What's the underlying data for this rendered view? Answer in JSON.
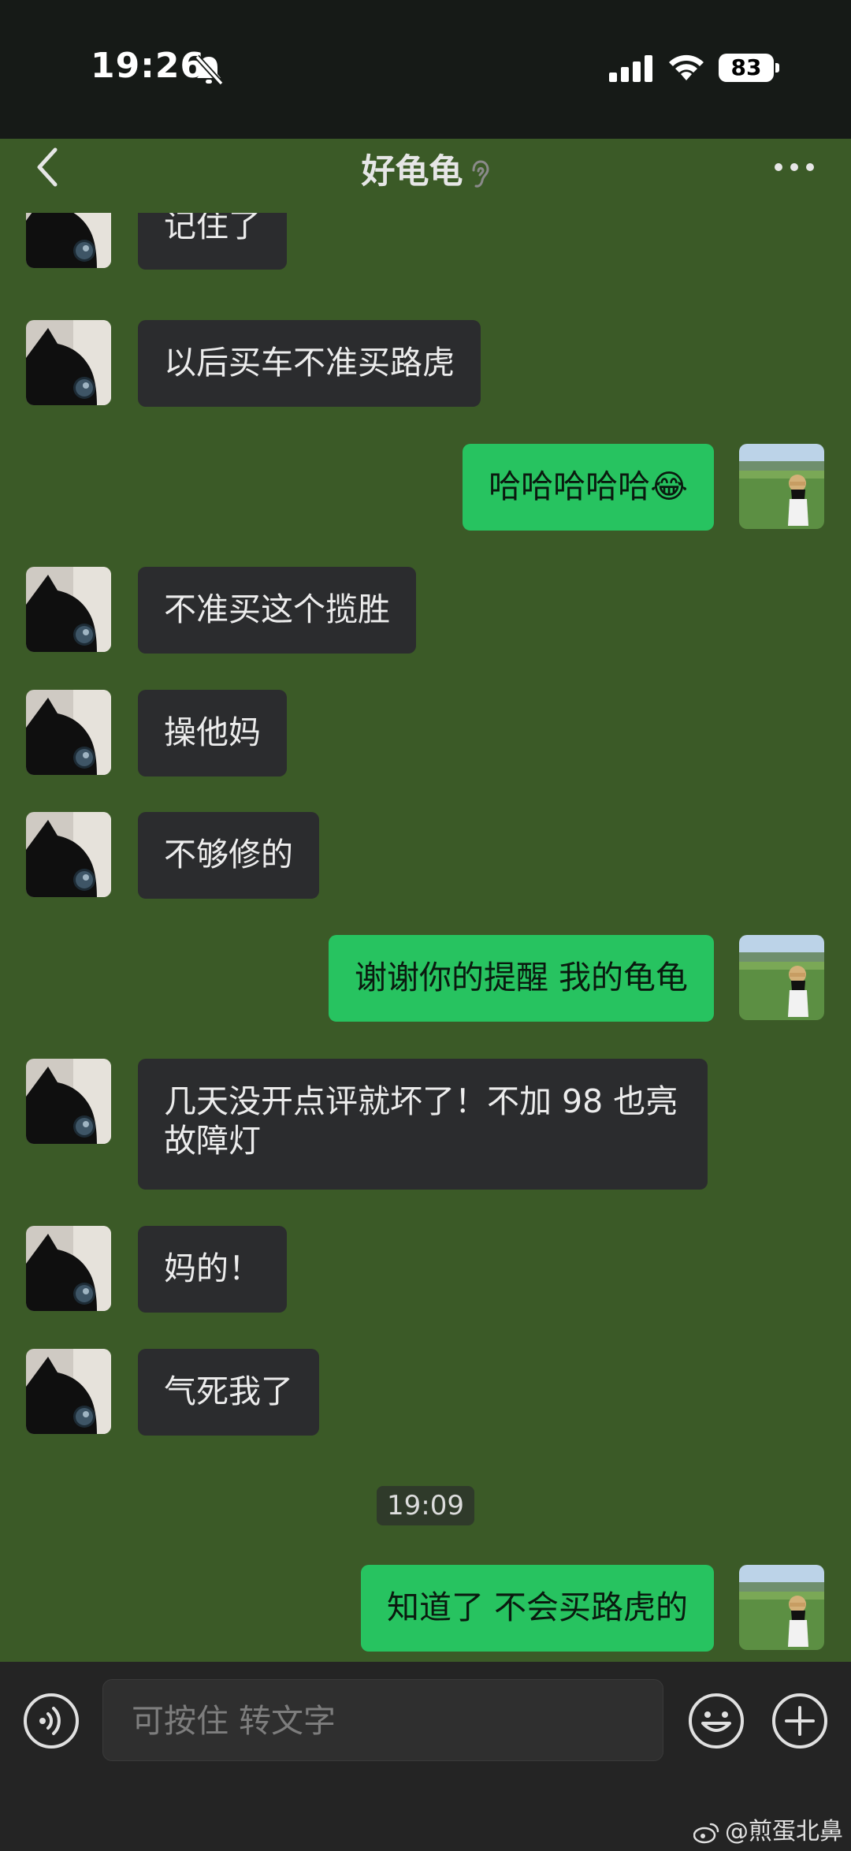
{
  "status": {
    "time": "19:26",
    "battery": "83"
  },
  "header": {
    "title": "好龟龟"
  },
  "messages": [
    {
      "side": "in",
      "text": "记住了"
    },
    {
      "side": "in",
      "text": "以后买车不准买路虎"
    },
    {
      "side": "out",
      "text": "哈哈哈哈哈😂"
    },
    {
      "side": "in",
      "text": "不准买这个揽胜"
    },
    {
      "side": "in",
      "text": "操他妈"
    },
    {
      "side": "in",
      "text": "不够修的"
    },
    {
      "side": "out",
      "text": "谢谢你的提醒 我的龟龟"
    },
    {
      "side": "in",
      "text": "几天没开点评就坏了！不加 98 也亮故障灯"
    },
    {
      "side": "in",
      "text": "妈的！"
    },
    {
      "side": "in",
      "text": "气死我了"
    },
    {
      "side": "out",
      "text": "知道了 不会买路虎的"
    }
  ],
  "timestamp": "19:09",
  "input": {
    "placeholder": "可按住 转文字"
  },
  "watermark": "@煎蛋北鼻",
  "colors": {
    "chat_bg": "#3b5a27",
    "incoming_bubble": "#2b2c2e",
    "outgoing_bubble": "#27c360"
  }
}
